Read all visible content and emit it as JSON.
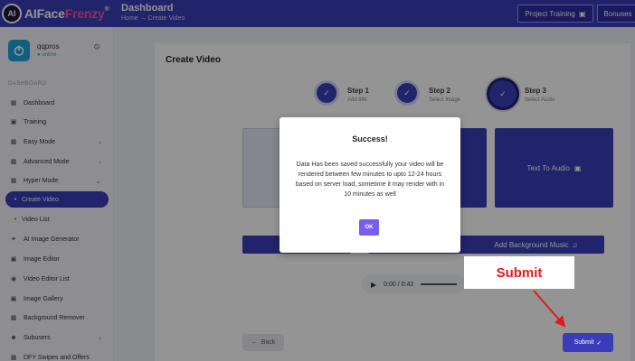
{
  "app": {
    "logo_badge": "AI",
    "logo_main": "AIFace",
    "logo_accent": "Frenzy",
    "logo_tm": "®"
  },
  "header": {
    "title": "Dashboard",
    "breadcrumb": "Home → Create Video",
    "project_training_label": "Project Training",
    "bonuses_label": "Bonuses"
  },
  "user": {
    "name": "qqpros",
    "status": "● online"
  },
  "sidebar": {
    "section_label": "DASHBOARD",
    "items": [
      {
        "label": "Dashboard",
        "icon": "dashboard-icon"
      },
      {
        "label": "Training",
        "icon": "training-icon"
      },
      {
        "label": "Easy Mode",
        "icon": "easy-mode-icon"
      },
      {
        "label": "Advanced Mode",
        "icon": "advanced-mode-icon"
      },
      {
        "label": "Hyper Mode",
        "icon": "hyper-mode-icon"
      },
      {
        "label": "Create Video",
        "icon": "bullet-icon"
      },
      {
        "label": "Video List",
        "icon": "bullet-icon"
      },
      {
        "label": "AI Image Generator",
        "icon": "image-generator-icon"
      },
      {
        "label": "Image Editor",
        "icon": "image-editor-icon"
      },
      {
        "label": "Video Editor List",
        "icon": "video-editor-icon"
      },
      {
        "label": "Image Gallery",
        "icon": "gallery-icon"
      },
      {
        "label": "Background Remover",
        "icon": "remover-icon"
      },
      {
        "label": "Subusers",
        "icon": "users-icon"
      },
      {
        "label": "DFY Swipes and Offers",
        "icon": "offers-icon"
      }
    ]
  },
  "main": {
    "card_title": "Create Video",
    "steps": [
      {
        "label": "Step 1",
        "sub": "Add title"
      },
      {
        "label": "Step 2",
        "sub": "Select Image"
      },
      {
        "label": "Step 3",
        "sub": "Select Audio"
      }
    ],
    "text_to_audio_label": "Text To Audio",
    "add_bg_music_label": "Add Background Music",
    "audio_time": "0:00 / 0:42",
    "back_label": "Back",
    "submit_label": "Submit"
  },
  "modal": {
    "title": "Success!",
    "body": "Data Has been saved successfully your video will be rendered between few minutes to upto 12-24 hours based on server load, sometime it may render with in 10 minutes as well",
    "ok_label": "OK"
  },
  "annotation": {
    "label": "Submit"
  },
  "colors": {
    "primary": "#3a3db8",
    "ok_button": "#7b5cf0",
    "annotation_red": "#e01b1b",
    "online": "#3cb371"
  }
}
